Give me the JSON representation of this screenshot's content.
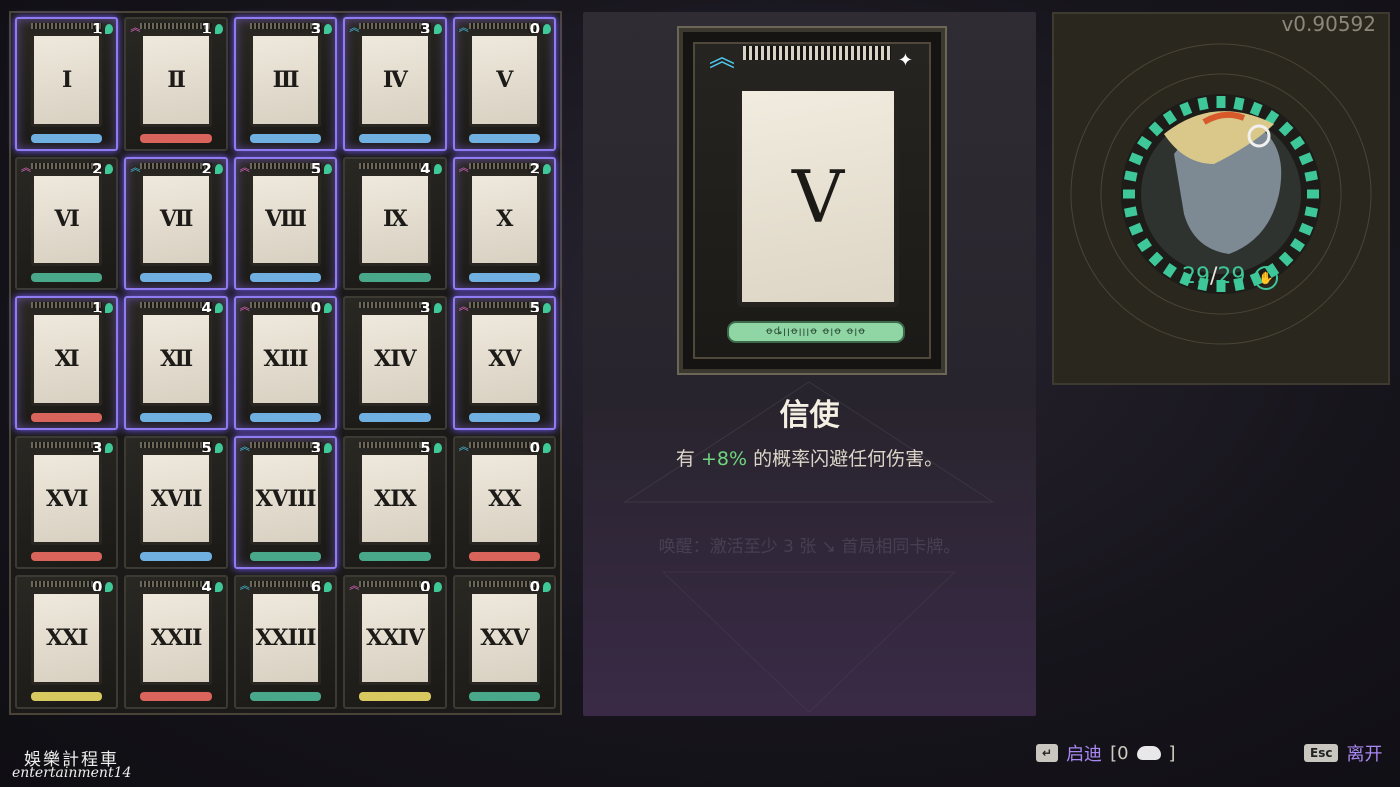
{
  "cards": [
    {
      "numeral": "Ⅰ",
      "count": "1",
      "rank": "",
      "selected": true,
      "bar": "#6fb0e0"
    },
    {
      "numeral": "Ⅱ",
      "count": "1",
      "rank": "pink",
      "selected": false,
      "bar": "#d8645c"
    },
    {
      "numeral": "Ⅲ",
      "count": "3",
      "rank": "",
      "selected": true,
      "bar": "#6fb0e0"
    },
    {
      "numeral": "Ⅳ",
      "count": "3",
      "rank": "cyan",
      "selected": true,
      "bar": "#6fb0e0"
    },
    {
      "numeral": "Ⅴ",
      "count": "0",
      "rank": "cyan",
      "selected": true,
      "bar": "#6fb0e0"
    },
    {
      "numeral": "Ⅵ",
      "count": "2",
      "rank": "pink",
      "selected": false,
      "bar": "#4aa88a"
    },
    {
      "numeral": "Ⅶ",
      "count": "2",
      "rank": "cyan",
      "selected": true,
      "bar": "#6fb0e0"
    },
    {
      "numeral": "Ⅷ",
      "count": "5",
      "rank": "pink",
      "selected": true,
      "bar": "#6fb0e0"
    },
    {
      "numeral": "Ⅸ",
      "count": "4",
      "rank": "",
      "selected": false,
      "bar": "#4aa88a"
    },
    {
      "numeral": "Ⅹ",
      "count": "2",
      "rank": "pink",
      "selected": true,
      "bar": "#6fb0e0"
    },
    {
      "numeral": "Ⅺ",
      "count": "1",
      "rank": "",
      "selected": true,
      "bar": "#d8645c"
    },
    {
      "numeral": "Ⅻ",
      "count": "4",
      "rank": "",
      "selected": true,
      "bar": "#6fb0e0"
    },
    {
      "numeral": "XIII",
      "count": "0",
      "rank": "pink",
      "selected": true,
      "bar": "#6fb0e0"
    },
    {
      "numeral": "XIV",
      "count": "3",
      "rank": "",
      "selected": false,
      "bar": "#6fb0e0"
    },
    {
      "numeral": "XV",
      "count": "5",
      "rank": "pink",
      "selected": true,
      "bar": "#6fb0e0"
    },
    {
      "numeral": "XVI",
      "count": "3",
      "rank": "",
      "selected": false,
      "bar": "#d8645c"
    },
    {
      "numeral": "XVII",
      "count": "5",
      "rank": "",
      "selected": false,
      "bar": "#6fb0e0"
    },
    {
      "numeral": "XVIII",
      "count": "3",
      "rank": "cyan",
      "selected": true,
      "bar": "#4aa88a"
    },
    {
      "numeral": "XIX",
      "count": "5",
      "rank": "",
      "selected": false,
      "bar": "#4aa88a"
    },
    {
      "numeral": "XX",
      "count": "0",
      "rank": "cyan",
      "selected": false,
      "bar": "#d8645c"
    },
    {
      "numeral": "XXI",
      "count": "0",
      "rank": "",
      "selected": false,
      "bar": "#d8c860"
    },
    {
      "numeral": "XXII",
      "count": "4",
      "rank": "",
      "selected": false,
      "bar": "#d8645c"
    },
    {
      "numeral": "XXIII",
      "count": "6",
      "rank": "cyan",
      "selected": false,
      "bar": "#4aa88a"
    },
    {
      "numeral": "XXIV",
      "count": "0",
      "rank": "pink",
      "selected": false,
      "bar": "#d8c860"
    },
    {
      "numeral": "XXV",
      "count": "0",
      "rank": "",
      "selected": false,
      "bar": "#4aa88a"
    }
  ],
  "detail": {
    "numeral": "Ⅴ",
    "banner_text": "ꝋȡꞁꞁꝋꞁꞁꞁꝋ ꝋꞁꝋ ꝋꞁꝋ",
    "title": "信使",
    "desc_prefix": "有 ",
    "desc_value": "+8%",
    "desc_suffix": " 的概率闪避任何伤害。",
    "faded_text": "唤醒：激活至少 3 张 ↘ 首局相同卡牌。"
  },
  "version": "v0.90592",
  "hp": {
    "current": "29",
    "max": "29",
    "separator": "/"
  },
  "hp_ring": {
    "segments": 32,
    "filled": 32,
    "color": "#3ec89a"
  },
  "footer": {
    "enter_key": "↵",
    "enter_label": "启迪",
    "enter_bracket_open": "[0",
    "enter_bracket_close": "]",
    "exit_key": "Esc",
    "exit_label": "离开"
  },
  "watermark": {
    "cn": "娛樂計程車",
    "en": "entertainment14"
  }
}
